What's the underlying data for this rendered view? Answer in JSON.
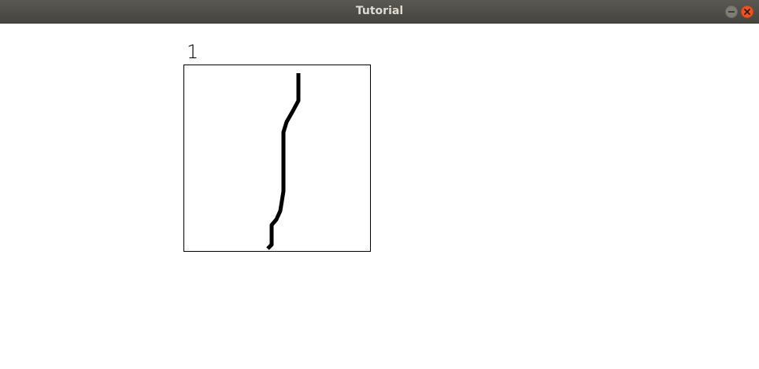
{
  "window": {
    "title": "Tutorial",
    "controls": {
      "minimize_icon": "minimize-icon",
      "close_icon": "close-icon",
      "close_color": "#e95420"
    }
  },
  "canvas": {
    "label": "1",
    "stroke_color": "#000000",
    "background": "#ffffff"
  }
}
